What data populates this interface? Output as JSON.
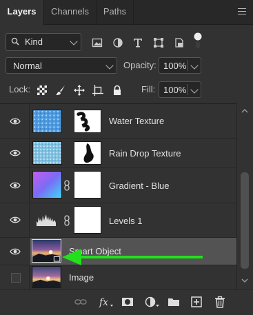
{
  "tabs": [
    {
      "label": "Layers",
      "active": true
    },
    {
      "label": "Channels",
      "active": false
    },
    {
      "label": "Paths",
      "active": false
    }
  ],
  "filter": {
    "kind_label": "Kind",
    "icons": [
      "image-filter-icon",
      "adjustment-filter-icon",
      "type-filter-icon",
      "shape-filter-icon",
      "smart-object-filter-icon",
      "filter-toggle-icon"
    ]
  },
  "blend": {
    "mode": "Normal",
    "opacity_label": "Opacity:",
    "opacity_value": "100%"
  },
  "lock": {
    "label": "Lock:",
    "fill_label": "Fill:",
    "fill_value": "100%",
    "icons": [
      "lock-transparent-pixels-icon",
      "lock-image-pixels-icon",
      "lock-position-icon",
      "lock-artboard-icon",
      "lock-all-icon"
    ]
  },
  "layers": [
    {
      "name": "Water Texture",
      "visible": true,
      "thumb": "water",
      "mask": "brush",
      "selected": false
    },
    {
      "name": "Rain Drop Texture",
      "visible": true,
      "thumb": "rain",
      "mask": "brush2",
      "selected": false
    },
    {
      "name": "Gradient - Blue",
      "visible": true,
      "thumb": "gradient",
      "mask": "white",
      "selected": false
    },
    {
      "name": "Levels 1",
      "visible": true,
      "thumb": "levels",
      "mask": "white",
      "selected": false
    },
    {
      "name": "Smart Object",
      "visible": true,
      "thumb": "photo",
      "mask": "",
      "selected": true
    },
    {
      "name": "Image",
      "visible": false,
      "thumb": "photo",
      "mask": "",
      "selected": false
    }
  ],
  "bottom_icons": [
    "link-layers-icon",
    "fx-icon",
    "add-mask-icon",
    "new-adjustment-icon",
    "new-group-icon",
    "new-layer-icon",
    "delete-layer-icon"
  ],
  "colors": {
    "panel_bg": "#323232",
    "selected_bg": "#535353",
    "annotation_arrow": "#22e01c"
  }
}
